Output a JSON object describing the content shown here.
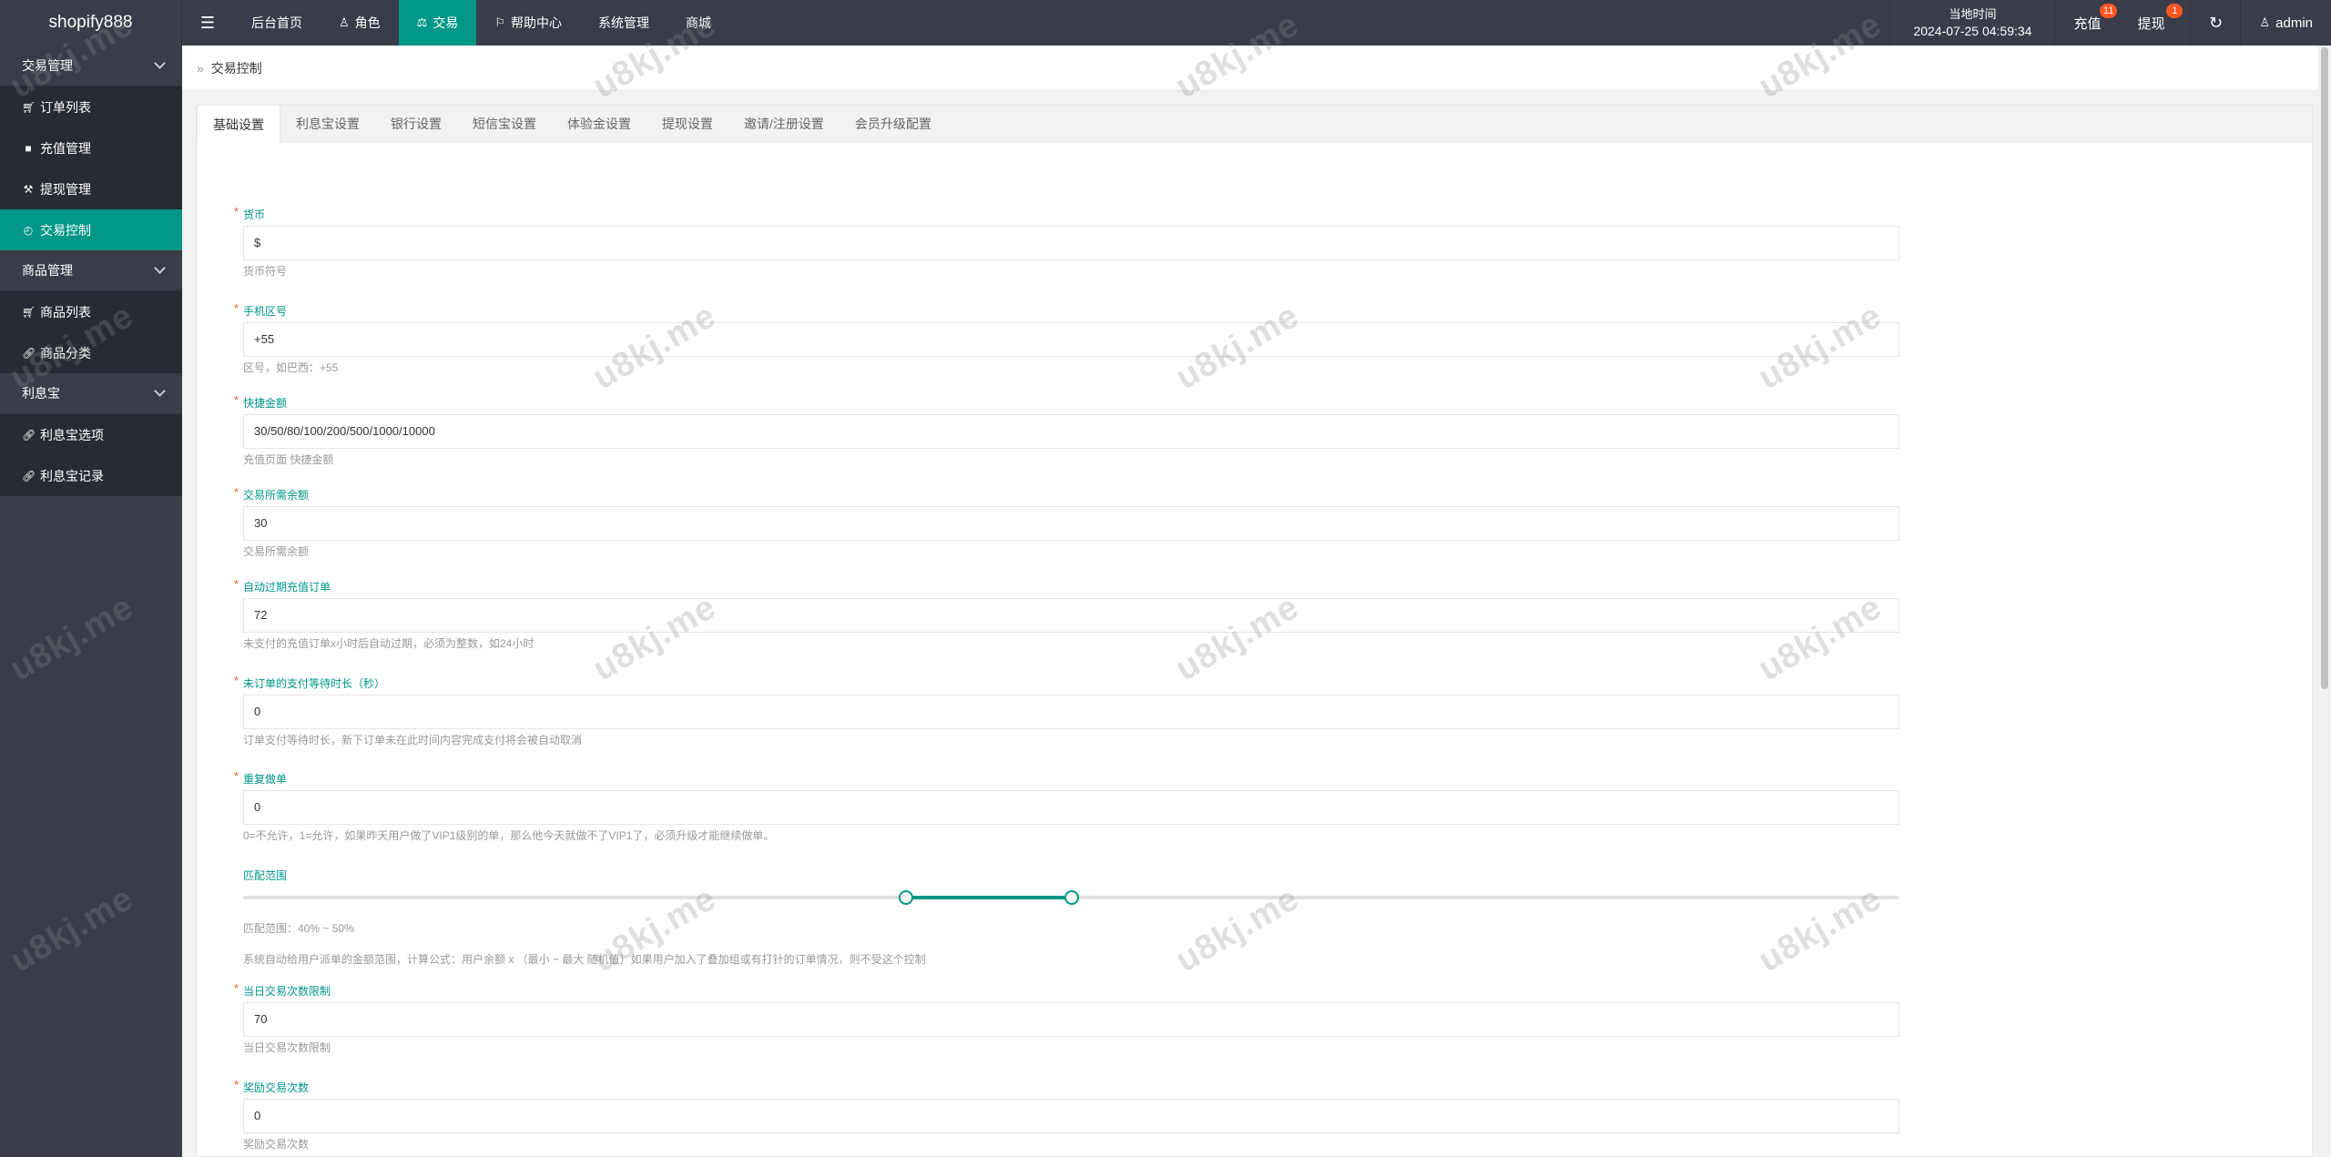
{
  "logo": "shopify888",
  "topnav": [
    {
      "label": "后台首页",
      "icon": ""
    },
    {
      "label": "角色",
      "icon": "user-icon"
    },
    {
      "label": "交易",
      "icon": "scale-icon",
      "active": true
    },
    {
      "label": "帮助中心",
      "icon": "flag-icon"
    },
    {
      "label": "系统管理",
      "icon": ""
    },
    {
      "label": "商城",
      "icon": ""
    }
  ],
  "clock": {
    "label": "当地时间",
    "time": "2024-07-25 04:59:34"
  },
  "topright": {
    "recharge_label": "充值",
    "recharge_badge": "11",
    "withdraw_label": "提现",
    "withdraw_badge": "1",
    "admin_label": "admin"
  },
  "sidebar": {
    "groups": [
      {
        "title": "交易管理",
        "items": [
          {
            "label": "订单列表",
            "icon": "cart-icon"
          },
          {
            "label": "充值管理",
            "icon": "message-icon"
          },
          {
            "label": "提现管理",
            "icon": "hammer-icon"
          },
          {
            "label": "交易控制",
            "icon": "dashboard-icon",
            "active": true
          }
        ]
      },
      {
        "title": "商品管理",
        "items": [
          {
            "label": "商品列表",
            "icon": "cart-icon"
          },
          {
            "label": "商品分类",
            "icon": "link-icon"
          }
        ]
      },
      {
        "title": "利息宝",
        "items": [
          {
            "label": "利息宝选项",
            "icon": "link-icon"
          },
          {
            "label": "利息宝记录",
            "icon": "link-icon"
          }
        ]
      }
    ]
  },
  "breadcrumb": "交易控制",
  "tabs": [
    "基础设置",
    "利息宝设置",
    "银行设置",
    "短信宝设置",
    "体验金设置",
    "提现设置",
    "邀请/注册设置",
    "会员升级配置"
  ],
  "form": {
    "currency": {
      "label": "货币",
      "value": "$",
      "help": "货币符号"
    },
    "phone_code": {
      "label": "手机区号",
      "value": "+55",
      "help": "区号，如巴西：+55"
    },
    "quick_amount": {
      "label": "快捷金额",
      "value": "30/50/80/100/200/500/1000/10000",
      "help": "充值页面 快捷金额"
    },
    "min_balance": {
      "label": "交易所需余额",
      "value": "30",
      "help": "交易所需余额"
    },
    "auto_expire": {
      "label": "自动过期充值订单",
      "value": "72",
      "help": "未支付的充值订单x小时后自动过期，必须为整数，如24小时"
    },
    "wait_time": {
      "label": "未订单的支付等待时长（秒）",
      "value": "0",
      "help": "订单支付等待时长，新下订单未在此时间内容完成支付将会被自动取消"
    },
    "repeat_order": {
      "label": "重复做单",
      "value": "0",
      "help": "0=不允许，1=允许，如果昨天用户做了VIP1级别的单，那么他今天就做不了VIP1了，必须升级才能继续做单。"
    },
    "match_range": {
      "label": "匹配范围",
      "min": 40,
      "max": 50,
      "range_text": "匹配范围：40% ~ 50%",
      "help": "系统自动给用户派单的金额范围，计算公式：用户余额 x （最小 ~ 最大 随机值）如果用户加入了叠加组或有打针的订单情况，则不受这个控制"
    },
    "daily_limit": {
      "label": "当日交易次数限制",
      "value": "70",
      "help": "当日交易次数限制"
    },
    "reward_count": {
      "label": "奖励交易次数",
      "value": "0",
      "help": "奖励交易次数"
    }
  },
  "watermark": "u8kj.me"
}
